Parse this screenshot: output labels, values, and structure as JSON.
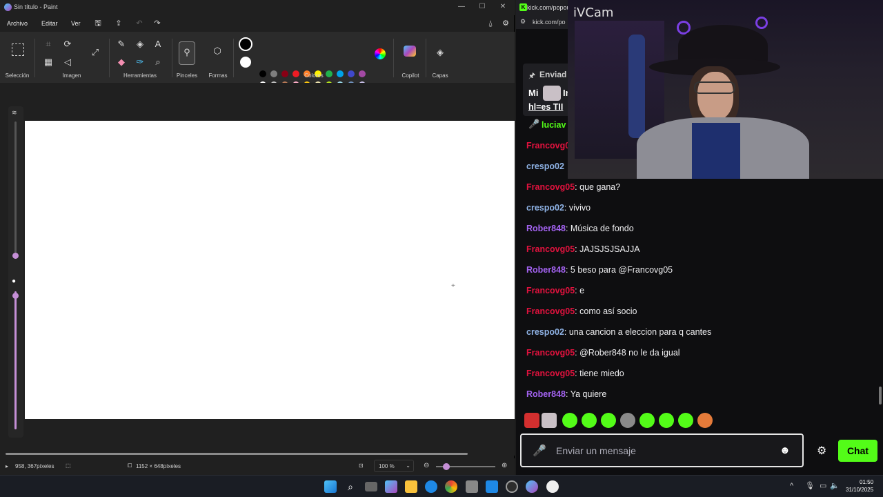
{
  "paint": {
    "window_title": "Sin título - Paint",
    "menu": [
      "Archivo",
      "Editar",
      "Ver"
    ],
    "groups": {
      "seleccion": "Selección",
      "imagen": "Imagen",
      "herramientas": "Herramientas",
      "pinceles": "Pinceles",
      "formas": "Formas",
      "colores": "Colores",
      "copilot": "Copilot",
      "capas": "Capas"
    },
    "palette_row1": [
      "#000000",
      "#7f7f7f",
      "#880015",
      "#ed1c24",
      "#ff7f27",
      "#fff200",
      "#22b14c",
      "#00a2e8",
      "#3f48cc",
      "#a349a4"
    ],
    "palette_row2": [
      "#ffffff",
      "#c3c3c3",
      "#b97a57",
      "#ffaec9",
      "#ffc90e",
      "#efe4b0",
      "#b5e61d",
      "#99d9ea",
      "#7092be",
      "#c8bfe7"
    ],
    "status": {
      "cursor_pos": "958, 367píxeles",
      "canvas_size": "1152 × 648píxeles",
      "zoom": "100 %"
    }
  },
  "browser": {
    "tab_title": "kick.com/popout",
    "url": "kick.com/po"
  },
  "webcam": {
    "label": "iVCam"
  },
  "chat": {
    "pinned_header": "Enviad",
    "pinned_line1": "Mi",
    "pinned_line1b": "In",
    "pinned_line2": "hl=es TII",
    "top_user": "luciav",
    "messages": [
      {
        "user": "Francovg0",
        "color": "#e2123e",
        "text": ""
      },
      {
        "user": "crespo02",
        "color": "#8fb3e6",
        "text": ""
      },
      {
        "user": "Francovg05",
        "color": "#e2123e",
        "text": ": que gana?"
      },
      {
        "user": "crespo02",
        "color": "#8fb3e6",
        "text": ": vivivo"
      },
      {
        "user": "Rober848",
        "color": "#a463f2",
        "text": ": Música de fondo"
      },
      {
        "user": "Francovg05",
        "color": "#e2123e",
        "text": ": JAJSJSJSAJJA"
      },
      {
        "user": "Rober848",
        "color": "#a463f2",
        "text": ": 5 beso para @Francovg05"
      },
      {
        "user": "Francovg05",
        "color": "#e2123e",
        "text": ": e"
      },
      {
        "user": "Francovg05",
        "color": "#e2123e",
        "text": ": como así socio"
      },
      {
        "user": "crespo02",
        "color": "#8fb3e6",
        "text": ": una cancion a eleccion para q cantes"
      },
      {
        "user": "Francovg05",
        "color": "#e2123e",
        "text": ": @Rober848 no le da igual"
      },
      {
        "user": "Francovg05",
        "color": "#e2123e",
        "text": ": tiene miedo"
      },
      {
        "user": "Rober848",
        "color": "#a463f2",
        "text": ": Ya quiere"
      }
    ],
    "input_placeholder": "Enviar un mensaje",
    "send_label": "Chat"
  },
  "taskbar": {
    "time": "01:50",
    "date": "31/10/2025"
  }
}
